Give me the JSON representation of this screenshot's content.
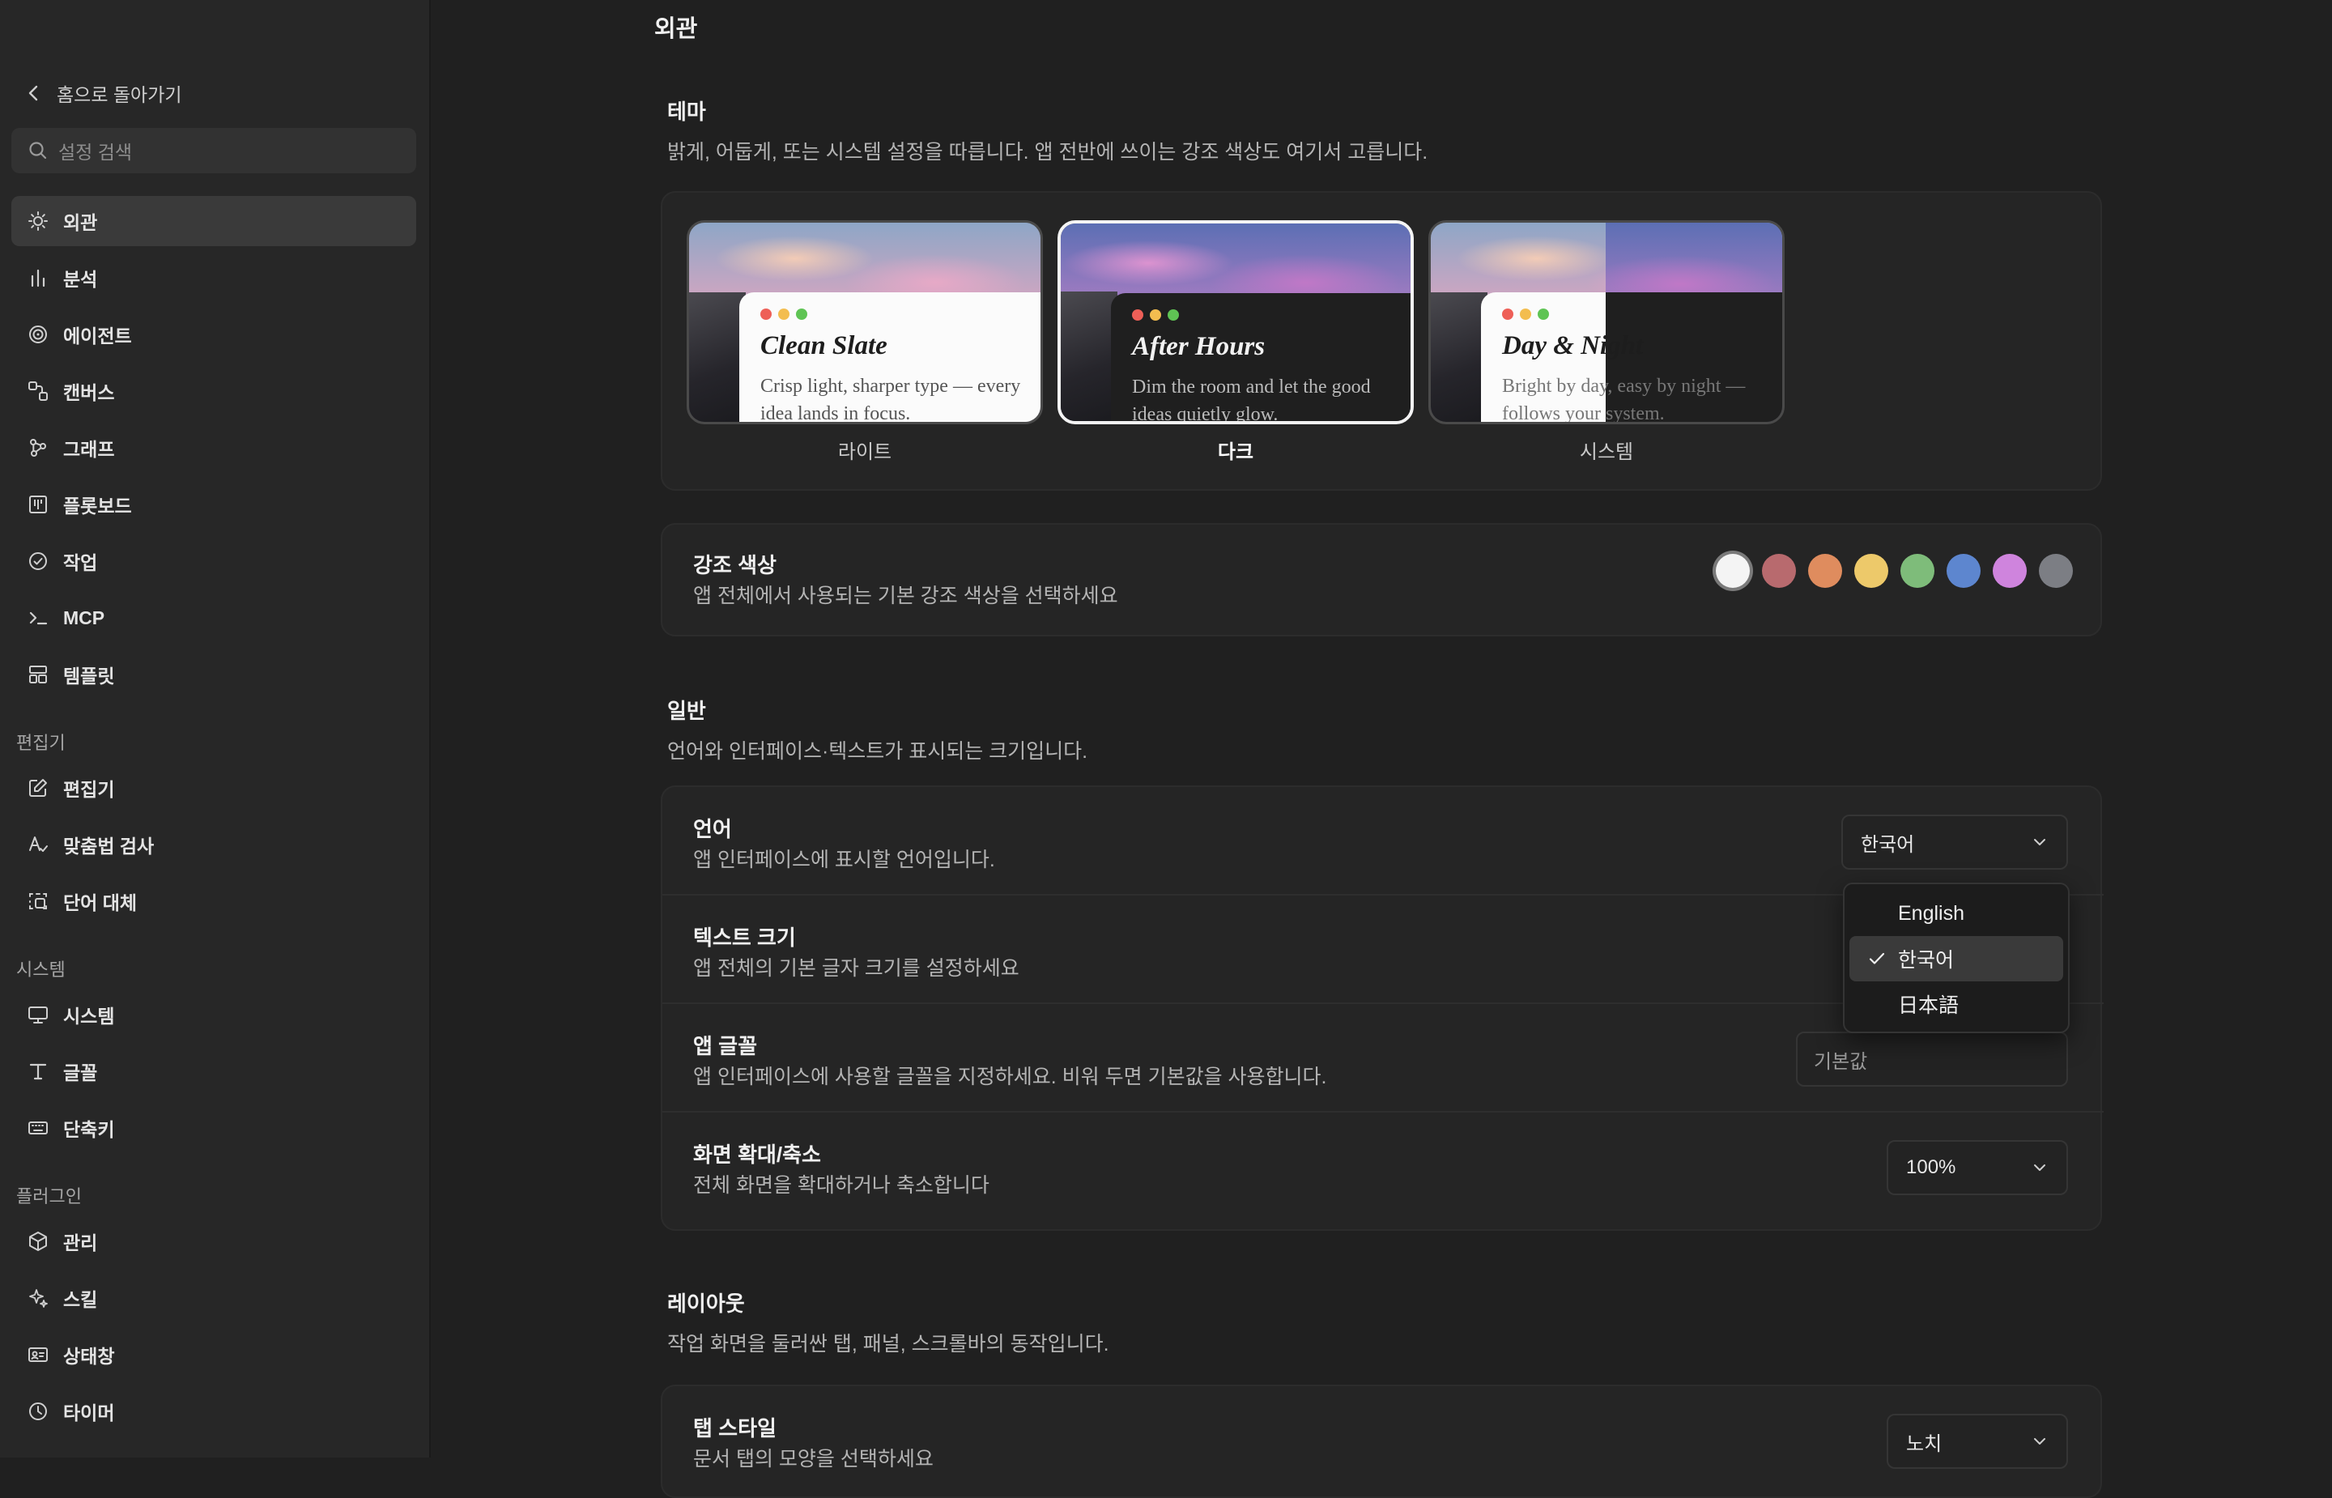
{
  "sidebar": {
    "back_label": "홈으로 돌아가기",
    "search_placeholder": "설정 검색",
    "items": [
      {
        "label": "외관",
        "icon": "sun-icon"
      },
      {
        "label": "분석",
        "icon": "bar-chart-icon"
      },
      {
        "label": "에이전트",
        "icon": "spiral-icon"
      },
      {
        "label": "캔버스",
        "icon": "canvas-icon"
      },
      {
        "label": "그래프",
        "icon": "graph-icon"
      },
      {
        "label": "플롯보드",
        "icon": "board-icon"
      },
      {
        "label": "작업",
        "icon": "check-circle-icon"
      },
      {
        "label": "MCP",
        "icon": "terminal-icon"
      },
      {
        "label": "템플릿",
        "icon": "template-icon"
      }
    ],
    "editor_section": "편집기",
    "editor_items": [
      {
        "label": "편집기",
        "icon": "edit-icon"
      },
      {
        "label": "맞춤법 검사",
        "icon": "spellcheck-icon"
      },
      {
        "label": "단어 대체",
        "icon": "replace-icon"
      }
    ],
    "system_section": "시스템",
    "system_items": [
      {
        "label": "시스템",
        "icon": "monitor-icon"
      },
      {
        "label": "글꼴",
        "icon": "type-icon"
      },
      {
        "label": "단축키",
        "icon": "keyboard-icon"
      }
    ],
    "plugin_section": "플러그인",
    "plugin_items": [
      {
        "label": "관리",
        "icon": "box-icon"
      },
      {
        "label": "스킬",
        "icon": "sparkle-icon"
      },
      {
        "label": "상태창",
        "icon": "id-card-icon"
      },
      {
        "label": "타이머",
        "icon": "clock-icon"
      }
    ]
  },
  "main": {
    "page_title": "외관",
    "theme": {
      "title": "테마",
      "desc": "밝게, 어둡게, 또는 시스템 설정을 따릅니다. 앱 전반에 쓰이는 강조 색상도 여기서 고릅니다.",
      "options": [
        {
          "name": "Clean Slate",
          "desc": "Crisp light, sharper type — every idea lands in focus.",
          "label": "라이트"
        },
        {
          "name": "After Hours",
          "desc": "Dim the room and let the good ideas quietly glow.",
          "label": "다크"
        },
        {
          "name": "Day & Night",
          "desc": "Bright by day, easy by night — follows your system.",
          "label": "시스템"
        }
      ]
    },
    "accent": {
      "title": "강조 색상",
      "desc": "앱 전체에서 사용되는 기본 강조 색상을 선택하세요",
      "colors": [
        "#f4f4f4",
        "#b86a6e",
        "#df8c5e",
        "#edc96a",
        "#7ebc7a",
        "#5d86cf",
        "#cf84dd",
        "#7c7e84"
      ]
    },
    "general": {
      "title": "일반",
      "desc": "언어와 인터페이스·텍스트가 표시되는 크기입니다.",
      "language": {
        "label": "언어",
        "desc": "앱 인터페이스에 표시할 언어입니다.",
        "value": "한국어"
      },
      "text_size": {
        "label": "텍스트 크기",
        "desc": "앱 전체의 기본 글자 크기를 설정하세요"
      },
      "app_font": {
        "label": "앱 글꼴",
        "desc": "앱 인터페이스에 사용할 글꼴을 지정하세요. 비워 두면 기본값을 사용합니다.",
        "placeholder": "기본값"
      },
      "zoom": {
        "label": "화면 확대/축소",
        "desc": "전체 화면을 확대하거나 축소합니다",
        "value": "100%"
      }
    },
    "layout": {
      "title": "레이아웃",
      "desc": "작업 화면을 둘러싼 탭, 패널, 스크롤바의 동작입니다.",
      "tab_style": {
        "label": "탭 스타일",
        "desc": "문서 탭의 모양을 선택하세요",
        "value": "노치"
      }
    },
    "language_menu": {
      "options": [
        "English",
        "한국어",
        "日本語"
      ]
    }
  },
  "colors": {
    "traffic_red": "#ee5f57",
    "traffic_yellow": "#f3bd4f",
    "traffic_green": "#5fc454"
  }
}
